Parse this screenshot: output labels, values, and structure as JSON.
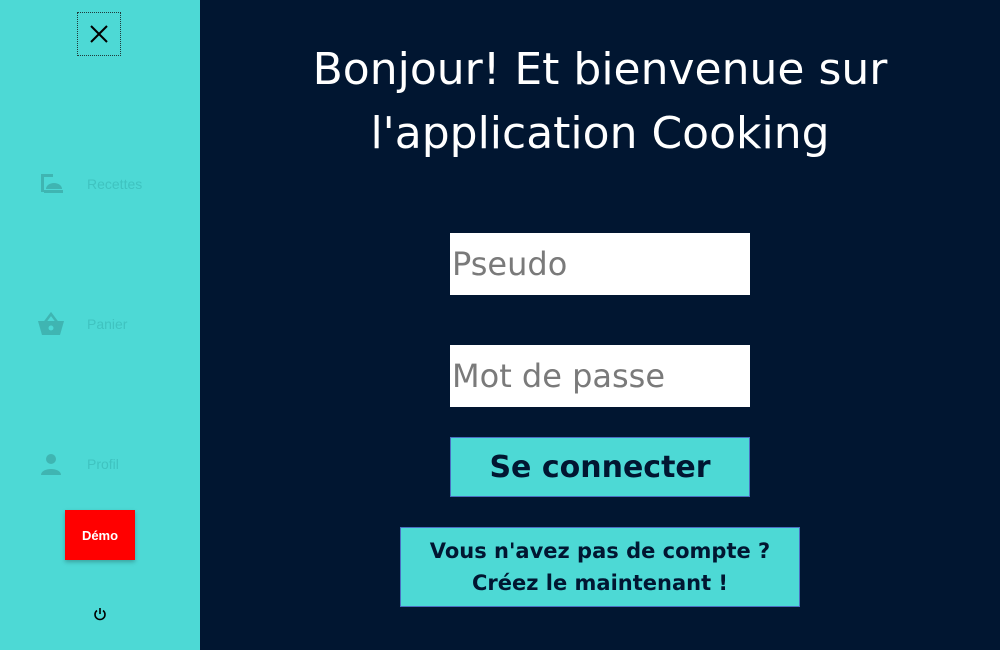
{
  "colors": {
    "sidebar_bg": "#4dd9d5",
    "main_bg": "#011631",
    "nav_faded": "#3fc3c0",
    "demo_red": "#ff0000",
    "button_border": "#4a6fc2"
  },
  "sidebar": {
    "close_icon": "close-icon",
    "items": [
      {
        "label": "Recettes",
        "icon": "recipe-dish-icon"
      },
      {
        "label": "Panier",
        "icon": "basket-icon"
      },
      {
        "label": "Profil",
        "icon": "person-icon"
      }
    ],
    "demo_label": "Démo",
    "power_icon": "power-icon"
  },
  "main": {
    "title_line1": "Bonjour! Et bienvenue sur",
    "title_line2": "l'application Cooking",
    "username_placeholder": "Pseudo",
    "password_placeholder": "Mot de passe",
    "login_label": "Se connecter",
    "signup_line1": "Vous n'avez pas de compte ?",
    "signup_line2": "Créez le maintenant !"
  }
}
